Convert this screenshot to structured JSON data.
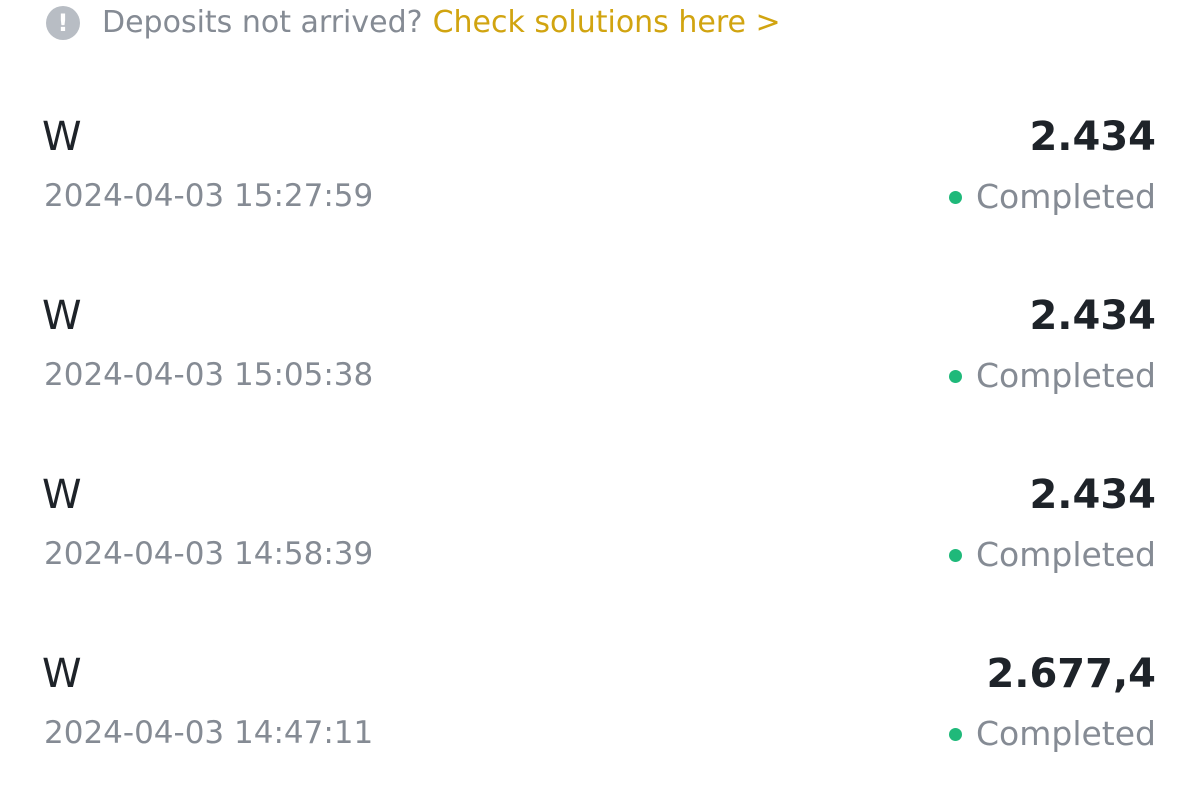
{
  "notice": {
    "icon": "exclamation-icon",
    "text": "Deposits not arrived?",
    "link": "Check solutions here >",
    "link_color": "#d1a410"
  },
  "transactions": [
    {
      "asset": "W",
      "time": "2024-04-03 15:27:59",
      "amount": "2.434",
      "status": "Completed"
    },
    {
      "asset": "W",
      "time": "2024-04-03 15:05:38",
      "amount": "2.434",
      "status": "Completed"
    },
    {
      "asset": "W",
      "time": "2024-04-03 14:58:39",
      "amount": "2.434",
      "status": "Completed"
    },
    {
      "asset": "W",
      "time": "2024-04-03 14:47:11",
      "amount": "2.677,4",
      "status": "Completed"
    }
  ],
  "colors": {
    "status_completed": "#1fb97a",
    "primary_text": "#1e2329",
    "secondary_text": "#858b94"
  }
}
